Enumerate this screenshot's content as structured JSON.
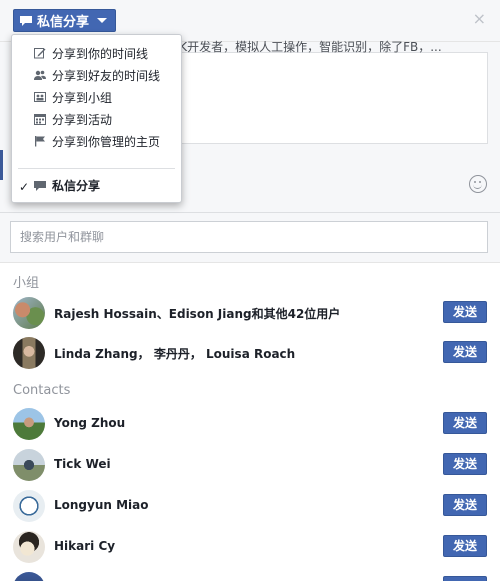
{
  "header": {
    "share_label": "私信分享",
    "close_glyph": "×"
  },
  "composer": {
    "preview_text": "PK开发者，模拟人工操作，智能识别，除了FB，..."
  },
  "menu": {
    "items": [
      {
        "label": "分享到你的时间线",
        "icon": "edit-icon"
      },
      {
        "label": "分享到好友的时间线",
        "icon": "friends-icon"
      },
      {
        "label": "分享到小组",
        "icon": "group-icon"
      },
      {
        "label": "分享到活动",
        "icon": "calendar-icon"
      },
      {
        "label": "分享到你管理的主页",
        "icon": "flag-icon"
      }
    ],
    "selected": {
      "label": "私信分享",
      "icon": "message-icon",
      "check": "✓"
    }
  },
  "search": {
    "placeholder": "搜索用户和群聊"
  },
  "groups": {
    "heading": "小组",
    "rows": [
      {
        "label": "Rajesh Hossain、Edison Jiang和其他42位用户",
        "send": "发送"
      },
      {
        "label": "Linda Zhang， 李丹丹， Louisa Roach",
        "send": "发送"
      }
    ]
  },
  "contacts": {
    "heading": "Contacts",
    "rows": [
      {
        "label": "Yong Zhou",
        "send": "发送"
      },
      {
        "label": "Tick Wei",
        "send": "发送"
      },
      {
        "label": "Longyun Miao",
        "send": "发送"
      },
      {
        "label": "Hikari Cy",
        "send": "发送"
      }
    ]
  },
  "colors": {
    "accent": "#4267b2",
    "border": "#365899"
  }
}
